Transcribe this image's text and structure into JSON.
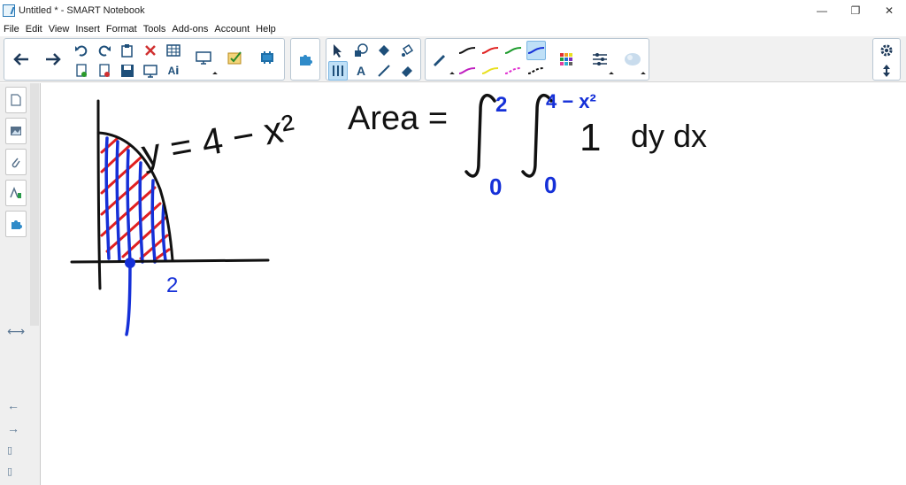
{
  "window": {
    "title": "Untitled * - SMART Notebook",
    "minimize": "—",
    "maximize": "❐",
    "close": "✕"
  },
  "menu": [
    "File",
    "Edit",
    "View",
    "Insert",
    "Format",
    "Tools",
    "Add-ons",
    "Account",
    "Help"
  ],
  "colors": {
    "ink_black": "#111111",
    "ink_blue": "#1530d8",
    "ink_red": "#e02020",
    "toolbar_bg": "#f1f1f1",
    "selected_tool": "#bfe0f7"
  },
  "toolbar_icons": {
    "back": "arrow-left-icon",
    "forward": "arrow-right-icon",
    "undo": "undo-icon",
    "redo": "redo-icon",
    "delete": "delete-x-icon",
    "table": "table-icon",
    "screen": "screen-shade-icon",
    "check": "measure-icon",
    "addons": "addon-icon",
    "select": "select-arrow-icon",
    "shapes": "shapes-icon",
    "fill": "fill-icon",
    "text": "text-icon",
    "line": "line-icon",
    "eraser": "eraser-icon",
    "pen": "pen-icon",
    "color_grid": "color-grid-icon",
    "properties": "properties-icon",
    "magic": "magic-pen-icon",
    "settings": "gear-icon"
  },
  "text_tool_label": "A",
  "ai_label": "Aⅰ",
  "canvas": {
    "curve_label": "y = 4 − x²",
    "tick_label": "2",
    "area_label": "Area =",
    "outer_upper": "2",
    "outer_lower": "0",
    "inner_upper": "4 − x²",
    "inner_lower": "0",
    "integrand": "1",
    "differentials": "dy dx"
  }
}
